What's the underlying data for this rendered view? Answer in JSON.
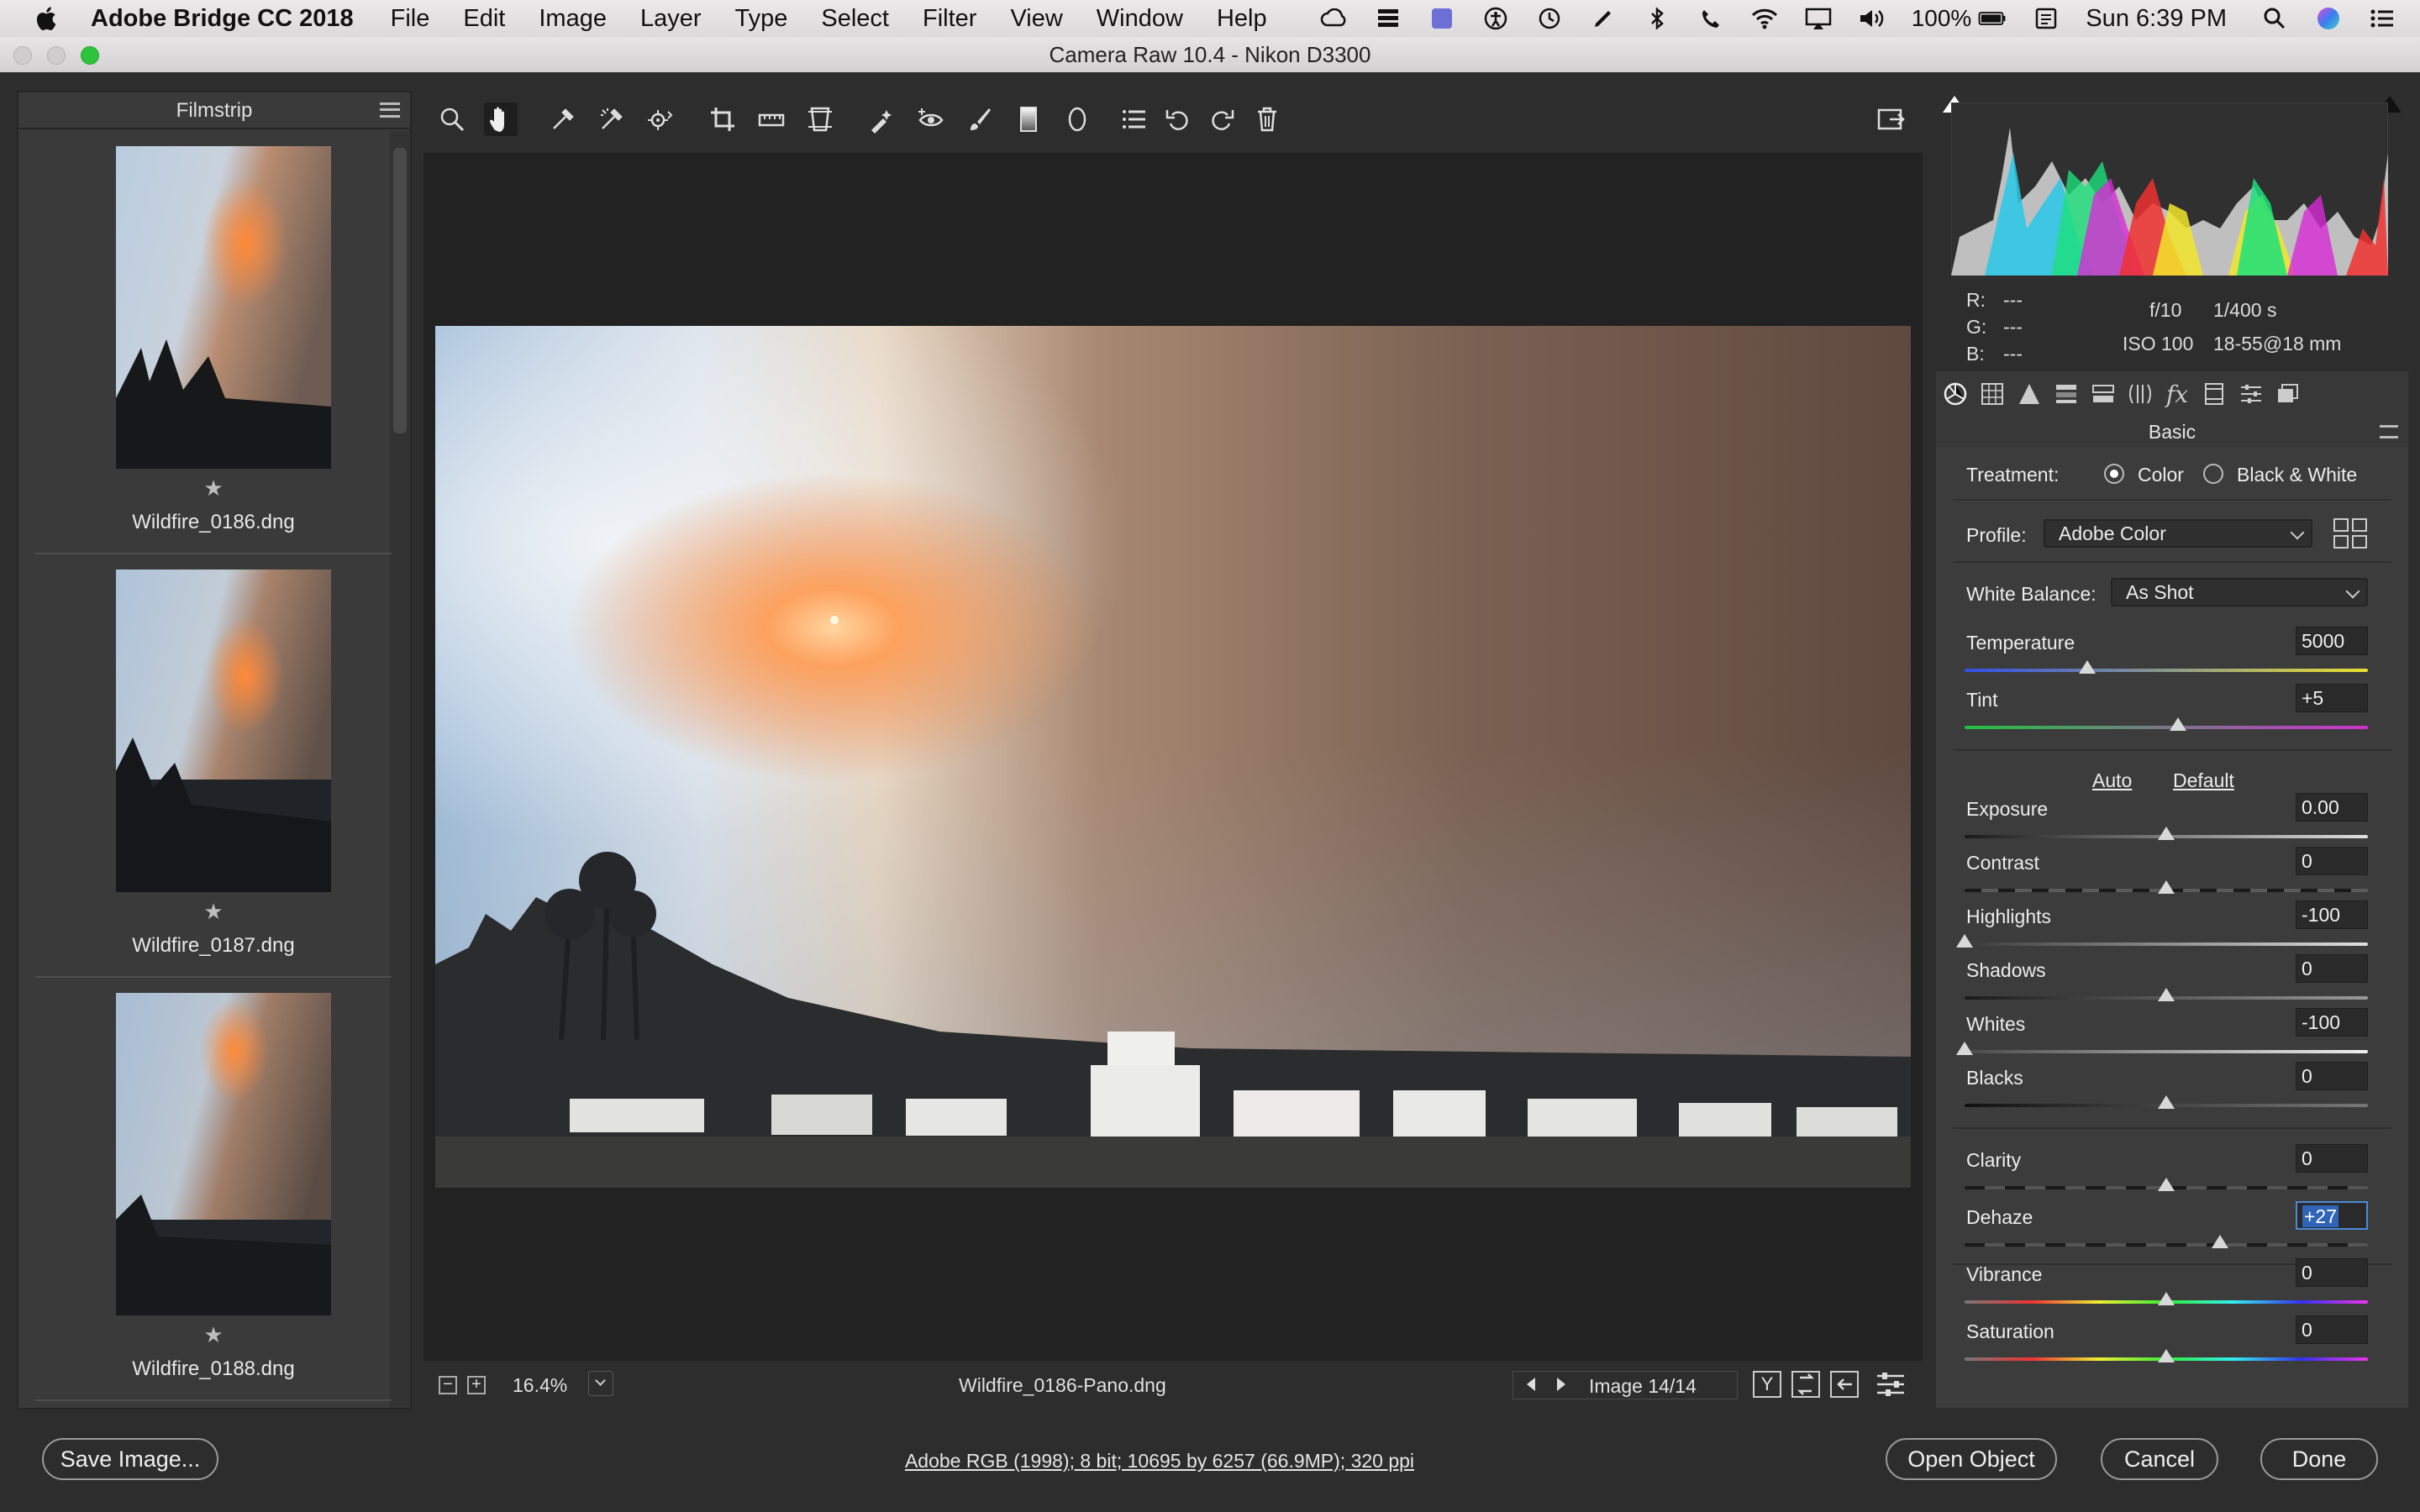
{
  "menubar": {
    "app_name": "Adobe Bridge CC 2018",
    "items": [
      "File",
      "Edit",
      "Image",
      "Layer",
      "Type",
      "Select",
      "Filter",
      "View",
      "Window",
      "Help"
    ],
    "battery": "100%",
    "clock": "Sun 6:39 PM"
  },
  "window": {
    "title": "Camera Raw 10.4  -  Nikon D3300"
  },
  "filmstrip": {
    "header": "Filmstrip",
    "items": [
      {
        "name": "Wildfire_0186.dng",
        "star": "★"
      },
      {
        "name": "Wildfire_0187.dng",
        "star": "★"
      },
      {
        "name": "Wildfire_0188.dng",
        "star": "★"
      }
    ]
  },
  "toolbar": {
    "tools": [
      "zoom-tool-icon",
      "hand-tool-icon",
      "white-balance-tool-icon",
      "color-sampler-tool-icon",
      "targeted-adjustment-tool-icon",
      "crop-tool-icon",
      "straighten-tool-icon",
      "transform-tool-icon",
      "spot-removal-tool-icon",
      "red-eye-removal-tool-icon",
      "adjustment-brush-icon",
      "graduated-filter-icon",
      "radial-filter-icon",
      "open-preferences-icon",
      "rotate-left-icon",
      "rotate-right-icon",
      "delete-icon"
    ]
  },
  "preview": {
    "zoom": "16.4%",
    "filename": "Wildfire_0186-Pano.dng",
    "image_counter": "Image 14/14"
  },
  "info": {
    "r_label": "R:",
    "r_value": "---",
    "g_label": "G:",
    "g_value": "---",
    "b_label": "B:",
    "b_value": "---",
    "aperture": "f/10",
    "shutter": "1/400 s",
    "iso": "ISO 100",
    "lens": "18-55@18 mm"
  },
  "basic": {
    "title": "Basic",
    "treatment_label": "Treatment:",
    "treatment_color": "Color",
    "treatment_bw": "Black & White",
    "profile_label": "Profile:",
    "profile_value": "Adobe Color",
    "wb_label": "White Balance:",
    "wb_value": "As Shot",
    "auto": "Auto",
    "default": "Default",
    "sliders": [
      {
        "label": "Temperature",
        "value": "5000"
      },
      {
        "label": "Tint",
        "value": "+5"
      },
      {
        "label": "Exposure",
        "value": "0.00"
      },
      {
        "label": "Contrast",
        "value": "0"
      },
      {
        "label": "Highlights",
        "value": "-100"
      },
      {
        "label": "Shadows",
        "value": "0"
      },
      {
        "label": "Whites",
        "value": "-100"
      },
      {
        "label": "Blacks",
        "value": "0"
      },
      {
        "label": "Clarity",
        "value": "0"
      },
      {
        "label": "Dehaze",
        "value": "+27"
      },
      {
        "label": "Vibrance",
        "value": "0"
      },
      {
        "label": "Saturation",
        "value": "0"
      }
    ]
  },
  "footer": {
    "save": "Save Image...",
    "workflow": "Adobe RGB (1998); 8 bit; 10695 by 6257 (66.9MP); 320 ppi",
    "open": "Open Object",
    "cancel": "Cancel",
    "done": "Done"
  },
  "colors": {
    "panel_bg": "#3c3c3c",
    "preview_bg": "#222222",
    "selection_blue": "#2f64b6"
  }
}
